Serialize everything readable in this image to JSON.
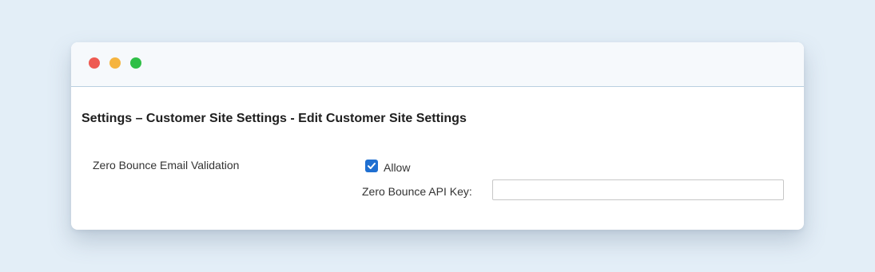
{
  "window": {
    "controls": [
      {
        "name": "close",
        "color": "#ee5a52"
      },
      {
        "name": "minimize",
        "color": "#f5b43f"
      },
      {
        "name": "maximize",
        "color": "#2fbf47"
      }
    ]
  },
  "page": {
    "title": "Settings – Customer Site Settings - Edit Customer Site Settings"
  },
  "settings": {
    "zero_bounce": {
      "label": "Zero Bounce Email Validation",
      "allow_label": "Allow",
      "allow_checked": true,
      "api_key_label": "Zero Bounce API Key:",
      "api_key_value": "",
      "api_key_placeholder": ""
    }
  },
  "colors": {
    "checkbox_accent": "#1f6fd1",
    "background": "#e3eef7"
  }
}
